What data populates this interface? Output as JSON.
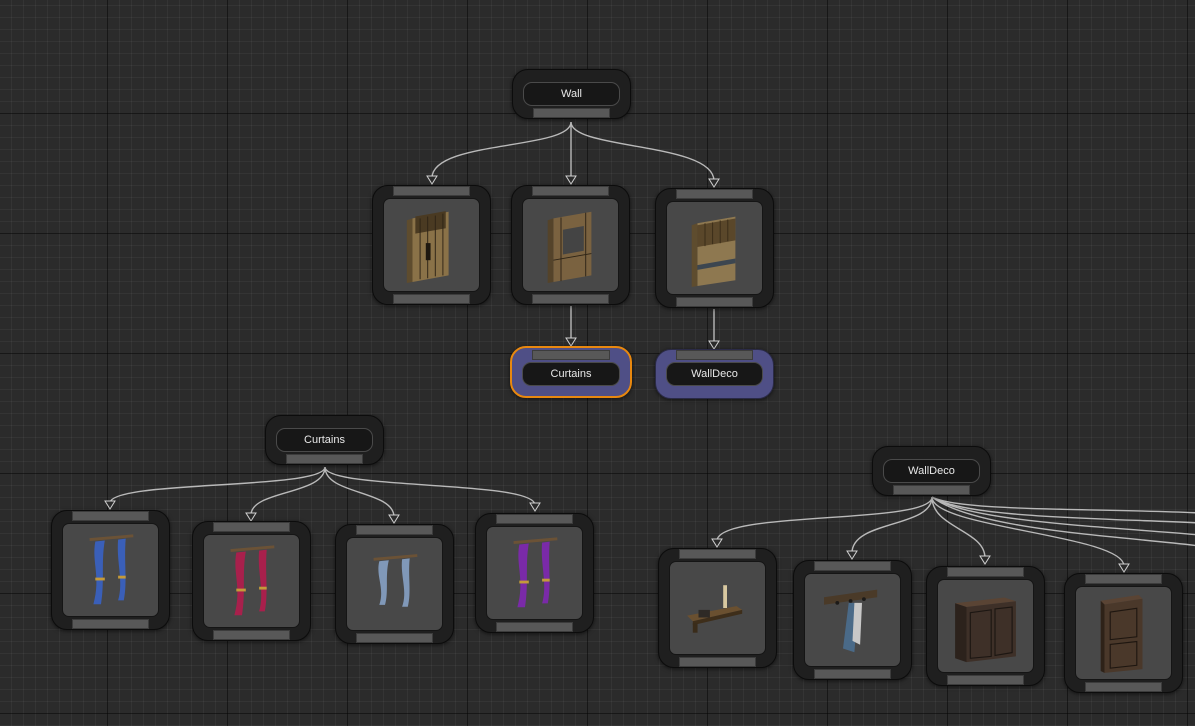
{
  "canvas": {
    "accent_color": "#e8880f",
    "highlight_color": "#4f4f86"
  },
  "nodes": {
    "wall": {
      "label": "Wall"
    },
    "curtains_link": {
      "label": "Curtains"
    },
    "walldeco_link": {
      "label": "WallDeco"
    },
    "curtains": {
      "label": "Curtains"
    },
    "walldeco": {
      "label": "WallDeco"
    },
    "wall_variants": [
      {
        "icon": "wall-panel-icon"
      },
      {
        "icon": "wall-window-icon"
      },
      {
        "icon": "wall-panel-icon"
      }
    ],
    "curtain_variants": [
      {
        "icon": "curtain-icon",
        "color": "#3a5fb8"
      },
      {
        "icon": "curtain-icon",
        "color": "#a8204c"
      },
      {
        "icon": "curtain-icon",
        "color": "#8098b8"
      },
      {
        "icon": "curtain-icon",
        "color": "#7a2aa8"
      }
    ],
    "walldeco_variants": [
      {
        "icon": "wall-shelf-icon"
      },
      {
        "icon": "towel-rack-icon"
      },
      {
        "icon": "dresser-icon"
      },
      {
        "icon": "cabinet-icon"
      }
    ]
  }
}
